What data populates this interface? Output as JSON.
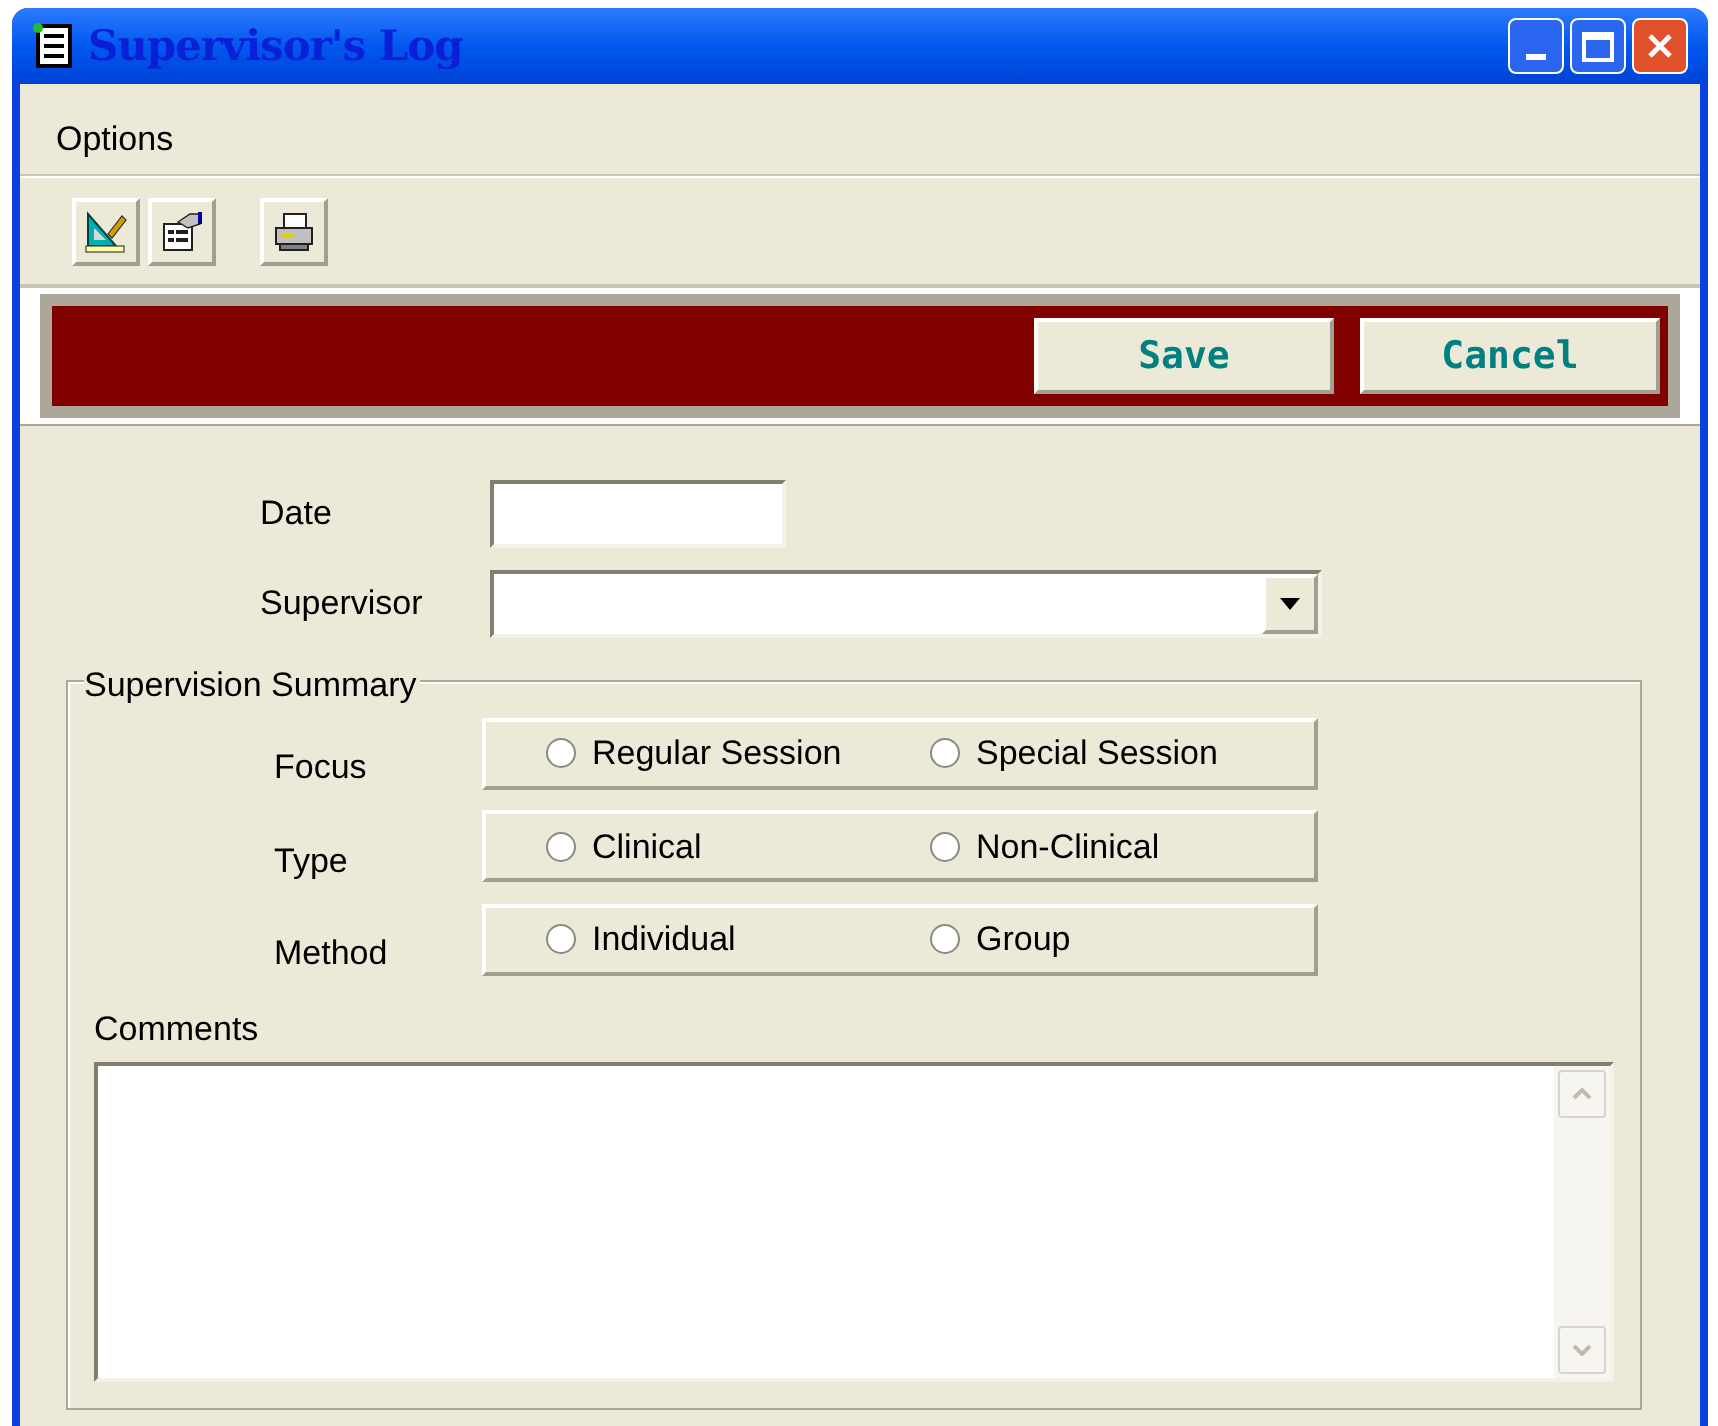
{
  "window": {
    "title": "Supervisor's Log"
  },
  "menu": [
    {
      "label": "Options"
    }
  ],
  "toolbar": [
    {
      "kind": "design"
    },
    {
      "kind": "properties"
    },
    {
      "kind": "print"
    }
  ],
  "actions": [
    {
      "label": "Save"
    },
    {
      "label": "Cancel"
    }
  ],
  "date": {
    "label": "Date"
  },
  "supervisor": {
    "label": "Supervisor"
  },
  "summary": {
    "title": "Supervision Summary",
    "groups": [
      {
        "label": "Focus",
        "options": [
          {
            "label": "Regular Session",
            "selected": false
          },
          {
            "label": "Special Session",
            "selected": false
          }
        ]
      },
      {
        "label": "Type",
        "options": [
          {
            "label": "Clinical",
            "selected": false
          },
          {
            "label": "Non-Clinical",
            "selected": false
          }
        ]
      },
      {
        "label": "Method",
        "options": [
          {
            "label": "Individual",
            "selected": false
          },
          {
            "label": "Group",
            "selected": false
          }
        ]
      }
    ],
    "comments": {
      "label": "Comments"
    }
  }
}
